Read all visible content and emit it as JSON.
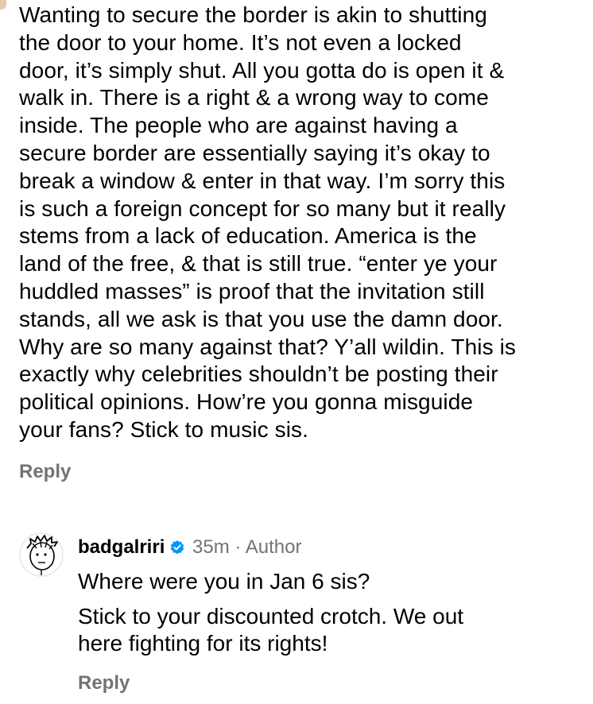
{
  "comment": {
    "lines": [
      "Wanting to secure the border is akin to shutting",
      "the door to your home. It’s not even a locked",
      "door, it’s simply shut. All you gotta do is open it &",
      "walk in. There is a right & a wrong way to come",
      "inside. The people who are against having a",
      "secure border are essentially saying it’s okay to",
      "break a window & enter in that way. I’m sorry this",
      "is such a foreign concept for so many but it really",
      "stems from a lack of education. America is the",
      "land of the free, & that is still true. “enter ye your",
      "huddled masses”  is proof that the invitation still",
      "stands, all we ask is that you use the damn door.",
      "Why are so many against that? Y’all wildin. This is",
      "exactly why celebrities shouldn’t be posting their",
      "political opinions. How’re you gonna misguide",
      "your fans? Stick to music sis."
    ],
    "reply_label": "Reply"
  },
  "reply": {
    "avatar_icon": "cartoon-face-avatar-icon",
    "username": "badgalriri",
    "verified_icon": "verified-badge-icon",
    "verified_color": "#0095f6",
    "time": "35m",
    "separator": " · ",
    "author_tag": "Author",
    "paragraph1": "Where were you in Jan 6 sis?",
    "paragraph2_lines": [
      "Stick to your discounted crotch. We out",
      "here fighting for its rights!"
    ],
    "reply_label": "Reply"
  }
}
